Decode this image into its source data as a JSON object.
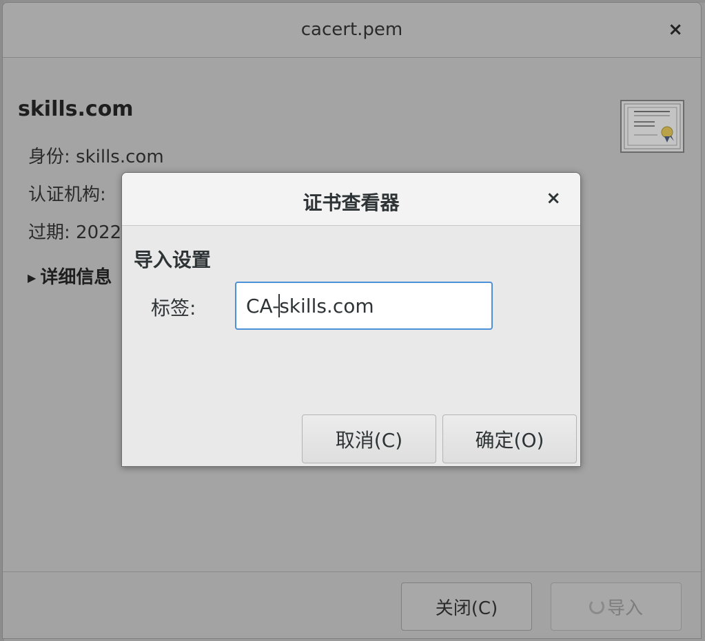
{
  "main_window": {
    "title": "cacert.pem",
    "close_glyph": "×",
    "cert_name": "skills.com",
    "identity_label": "身份:",
    "identity_value": "skills.com",
    "issuer_label": "认证机构:",
    "expiry_label": "过期:",
    "expiry_value_visible": "2022",
    "details_label": "详细信息",
    "details_toggle_glyph": "▶",
    "close_button": "关闭(C)",
    "import_button": "导入",
    "cert_icon": "certificate-icon"
  },
  "dialog": {
    "title": "证书查看器",
    "close_glyph": "×",
    "section_title": "导入设置",
    "label_text": "标签:",
    "input_value_before_caret": "CA-",
    "input_value_after_caret": "skills.com",
    "cancel_button": "取消(C)",
    "ok_button": "确定(O)",
    "accent_color": "#4a90d9"
  }
}
